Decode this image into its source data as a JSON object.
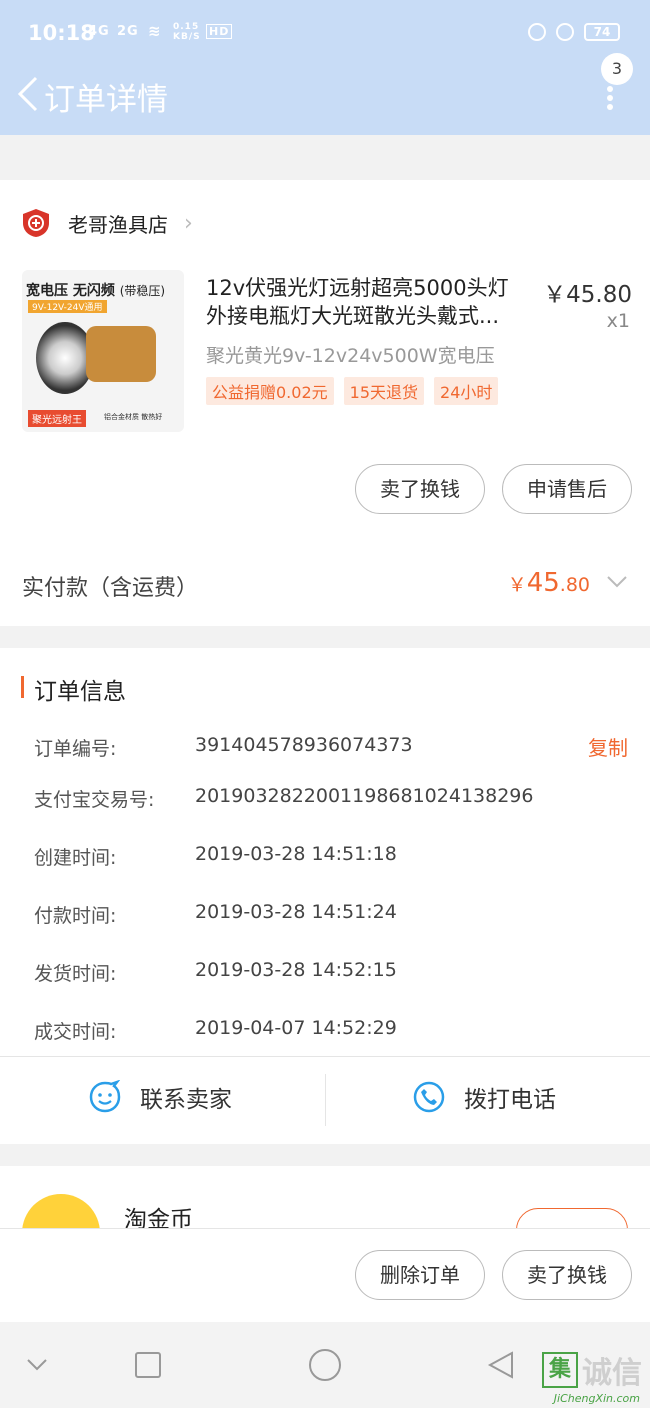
{
  "status_bar": {
    "time": "10:18",
    "signal1": "4G",
    "signal2": "2G",
    "speed": "0.15 KB/S",
    "hd": "HD",
    "battery": "74"
  },
  "header": {
    "title": "订单详情",
    "badge": "3"
  },
  "shop": {
    "name": "老哥渔具店"
  },
  "product": {
    "image_text": {
      "line1": "宽电压 无闪频",
      "line1b": "(带稳压)",
      "line2": "9V-12V-24V通用",
      "line3": "聚光远射王",
      "line4": "铝合金材质 散热好"
    },
    "title": "12v伏强光灯远射超亮5000头灯外接电瓶灯大光斑散光头戴式...",
    "price": "￥45.80",
    "qty": "x1",
    "sku": "聚光黄光9v-12v24v500W宽电压",
    "tags": [
      "公益捐赠0.02元",
      "15天退货",
      "24小时"
    ]
  },
  "buttons": {
    "sell": "卖了换钱",
    "after_sale": "申请售后",
    "delete": "删除订单",
    "sell2": "卖了换钱"
  },
  "payment": {
    "label": "实付款（含运费）",
    "currency": "￥",
    "int": "45",
    "dec": ".80"
  },
  "order_info": {
    "title": "订单信息",
    "copy": "复制",
    "rows": [
      {
        "k": "订单编号:",
        "v": "391404578936074373"
      },
      {
        "k": "支付宝交易号:",
        "v": "2019032822001198681024138296"
      },
      {
        "k": "创建时间:",
        "v": "2019-03-28 14:51:18"
      },
      {
        "k": "付款时间:",
        "v": "2019-03-28 14:51:24"
      },
      {
        "k": "发货时间:",
        "v": "2019-03-28 14:52:15"
      },
      {
        "k": "成交时间:",
        "v": "2019-04-07 14:52:29"
      }
    ]
  },
  "actions": {
    "contact": "联系卖家",
    "call": "拨打电话"
  },
  "coin": {
    "title": "淘金币"
  },
  "watermark": {
    "char": "集",
    "text": "诚信",
    "url": "JiChengXin.com"
  },
  "colors": {
    "header": "#c8dcf6",
    "accent": "#f06830",
    "blue_icon": "#2a9ee8"
  }
}
